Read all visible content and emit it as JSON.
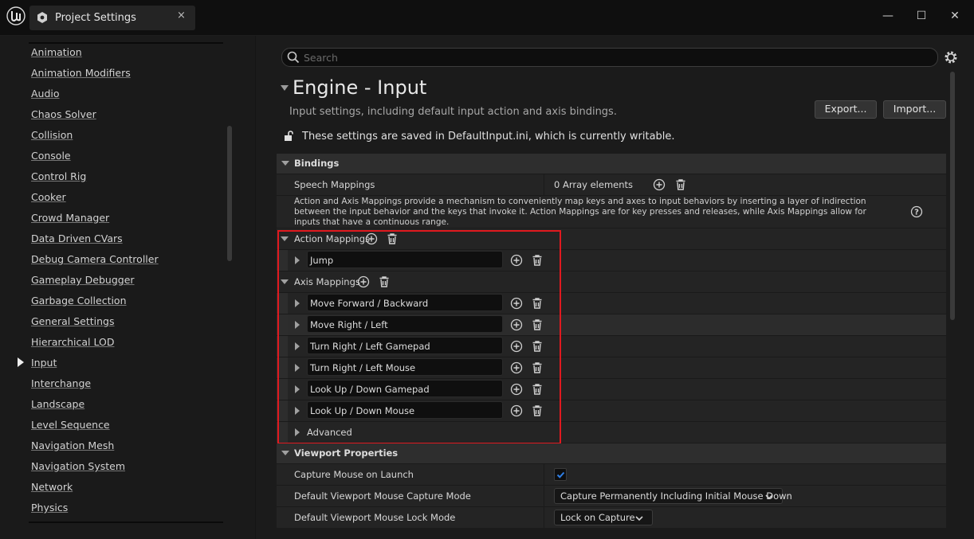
{
  "window": {
    "tab_title": "Project Settings",
    "tab_close": "×",
    "minimize": "—",
    "maximize": "☐",
    "close": "✕"
  },
  "sidebar": {
    "items": [
      {
        "label": "Animation"
      },
      {
        "label": "Animation Modifiers"
      },
      {
        "label": "Audio"
      },
      {
        "label": "Chaos Solver"
      },
      {
        "label": "Collision"
      },
      {
        "label": "Console"
      },
      {
        "label": "Control Rig"
      },
      {
        "label": "Cooker"
      },
      {
        "label": "Crowd Manager"
      },
      {
        "label": "Data Driven CVars"
      },
      {
        "label": "Debug Camera Controller"
      },
      {
        "label": "Gameplay Debugger"
      },
      {
        "label": "Garbage Collection"
      },
      {
        "label": "General Settings"
      },
      {
        "label": "Hierarchical LOD"
      },
      {
        "label": "Input"
      },
      {
        "label": "Interchange"
      },
      {
        "label": "Landscape"
      },
      {
        "label": "Level Sequence"
      },
      {
        "label": "Navigation Mesh"
      },
      {
        "label": "Navigation System"
      },
      {
        "label": "Network"
      },
      {
        "label": "Physics"
      }
    ],
    "selected": "Input"
  },
  "search": {
    "placeholder": "Search",
    "value": ""
  },
  "page": {
    "title": "Engine - Input",
    "description": "Input settings, including default input action and axis bindings.",
    "export_label": "Export...",
    "import_label": "Import...",
    "writable_note": "These settings are saved in DefaultInput.ini, which is currently writable."
  },
  "bindings": {
    "category": "Bindings",
    "speech_label": "Speech Mappings",
    "speech_value": "0 Array elements",
    "info_text": "Action and Axis Mappings provide a mechanism to conveniently map keys and axes to input behaviors by inserting a layer of indirection between the input behavior and the keys that invoke it. Action Mappings are for key presses and releases, while Axis Mappings allow for inputs that have a continuous range.",
    "action_label": "Action Mappings",
    "actions": [
      "Jump"
    ],
    "axis_label": "Axis Mappings",
    "axes": [
      "Move Forward / Backward",
      "Move Right / Left",
      "Turn Right / Left Gamepad",
      "Turn Right / Left Mouse",
      "Look Up / Down Gamepad",
      "Look Up / Down Mouse"
    ],
    "advanced_label": "Advanced"
  },
  "viewport": {
    "category": "Viewport Properties",
    "capture_label": "Capture Mouse on Launch",
    "capture_checked": true,
    "capture_mode_label": "Default Viewport Mouse Capture Mode",
    "capture_mode_value": "Capture Permanently Including Initial Mouse Down",
    "lock_mode_label": "Default Viewport Mouse Lock Mode",
    "lock_mode_value": "Lock on Capture"
  },
  "colors": {
    "highlight": "#e0191f",
    "accent": "#1e6fdc"
  }
}
